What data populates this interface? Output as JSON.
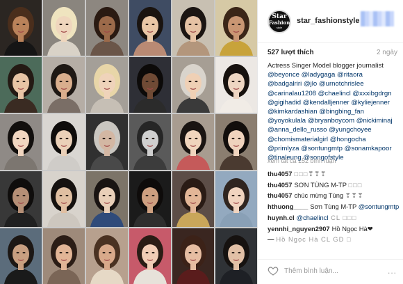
{
  "tiles": [
    {
      "bg": "#2b2622",
      "skin": "#b9825a",
      "hair": "#4a2e1c",
      "top": "#151515"
    },
    {
      "bg": "#8a857e",
      "skin": "#efd6bd",
      "hair": "#efe4bf",
      "top": "#d9d2c7"
    },
    {
      "bg": "#8d8780",
      "skin": "#9c6a4a",
      "hair": "#2a1a12",
      "top": "#6a5548"
    },
    {
      "bg": "#3f4c63",
      "skin": "#e9c7a6",
      "hair": "#1a1410",
      "top": "#b98a74"
    },
    {
      "bg": "#c8c0b2",
      "skin": "#e5c2a4",
      "hair": "#1b1512",
      "top": "#b3967c"
    },
    {
      "bg": "#d6c9a5",
      "skin": "#c99673",
      "hair": "#3b2618",
      "top": "#c8a33a"
    },
    {
      "bg": "#4c6b5a",
      "skin": "#e8c4a5",
      "hair": "#241a14",
      "top": "#3a2b22"
    },
    {
      "bg": "#b5ada5",
      "skin": "#d9ae8d",
      "hair": "#1e1814",
      "top": "#7a6e66"
    },
    {
      "bg": "#a49f98",
      "skin": "#efd3ba",
      "hair": "#e8d6a8",
      "top": "#c6bfb5"
    },
    {
      "bg": "#2e2f36",
      "skin": "#6f4a35",
      "hair": "#0c0a09",
      "top": "#2b2b2b"
    },
    {
      "bg": "#a69e94",
      "skin": "#efd0b5",
      "hair": "#d9d4cc",
      "top": "#3a3a3a"
    },
    {
      "bg": "#ece8e4",
      "skin": "#eed6c2",
      "hair": "#16110e",
      "top": "#f1ece6"
    },
    {
      "bg": "#8f8a86",
      "skin": "#f1d6c0",
      "hair": "#120f0d",
      "top": "#7c7670"
    },
    {
      "bg": "#d9d6d2",
      "skin": "#ead0b8",
      "hair": "#0e0c0b",
      "top": "#cfccc8"
    },
    {
      "bg": "#303030",
      "skin": "#d3b7a3",
      "hair": "#c9c6c0",
      "top": "#494949"
    },
    {
      "bg": "#5a5a5a",
      "skin": "#cfcfcf",
      "hair": "#262626",
      "top": "#3c3c3c"
    },
    {
      "bg": "#a89c90",
      "skin": "#f0d4bd",
      "hair": "#1a1412",
      "top": "#c55a5a"
    },
    {
      "bg": "#8b7e70",
      "skin": "#efd3bd",
      "hair": "#120e0c",
      "top": "#4a3a30"
    },
    {
      "bg": "#383838",
      "skin": "#b58f76",
      "hair": "#0f0d0c",
      "top": "#202020"
    },
    {
      "bg": "#d8d3cc",
      "skin": "#e0bfa2",
      "hair": "#15110f",
      "top": "#cdc7bf"
    },
    {
      "bg": "#7c7468",
      "skin": "#e9cfb8",
      "hair": "#191412",
      "top": "#2f4b7a"
    },
    {
      "bg": "#1b1b1b",
      "skin": "#cd9f80",
      "hair": "#0e0b0a",
      "top": "#2e2e2e"
    },
    {
      "bg": "#5c4d47",
      "skin": "#e3b697",
      "hair": "#2a1b15",
      "top": "#c9a65a"
    },
    {
      "bg": "#93a9bf",
      "skin": "#f0d4bf",
      "hair": "#2f2520",
      "top": "#89a0b6"
    },
    {
      "bg": "#5b6c7b",
      "skin": "#c89f80",
      "hair": "#1c1714",
      "top": "#1a1a1a"
    },
    {
      "bg": "#9e8a7a",
      "skin": "#e2b596",
      "hair": "#2b1d16",
      "top": "#7a6556"
    },
    {
      "bg": "#b7a08e",
      "skin": "#d8a98a",
      "hair": "#4a3222",
      "top": "#e6d9c6"
    },
    {
      "bg": "#c75a6a",
      "skin": "#f1cdb6",
      "hair": "#2a1c15",
      "top": "#e7e2da"
    },
    {
      "bg": "#3a2620",
      "skin": "#e6bda2",
      "hair": "#3c2218",
      "top": "#5a1c1c"
    },
    {
      "bg": "#2f3236",
      "skin": "#e2c0a6",
      "hair": "#161210",
      "top": "#1e2025"
    }
  ],
  "highlight_color": "#e3141f",
  "post": {
    "avatar_line1": "Star",
    "avatar_line2": "Fashion",
    "avatar_line3": "style",
    "username": "star_fashionstyle",
    "likes": "527 lượt thích",
    "time_ago": "2 ngày",
    "caption_text": "Actress Singer Model blogger journalist",
    "caption_tags": [
      "@beyonce @ladygaga @ritaora",
      "@badgalriri @jlo @urnotchrislee",
      "@carinalau1208 @chaelincl @xxxibgdrgn",
      "@gigihadid @kendalljenner @kyliejenner",
      "@kimkardashian @bingbing_fan",
      "@yoyokulala @bryanboycom @nickiminaj",
      "@anna_dello_russo @yungchoyee",
      "@chomismaterialgirl @hongocha",
      "@primlyza @sontungmtp @sonamkapoor",
      "@tinaleung @songofstyle"
    ],
    "view_comments": "xem tất cả 152 bình luận",
    "comments": [
      {
        "author": "thu4057",
        "pre": "",
        "mention": "",
        "text": "□□□❣❣❣"
      },
      {
        "author": "thu4057",
        "pre": "SƠN TÙNG M-TP ",
        "mention": "",
        "text": "□□□"
      },
      {
        "author": "thu4057",
        "pre": "chúc mừng Tùng ",
        "mention": "",
        "text": "❣❣❣"
      },
      {
        "author": "hthuong____",
        "pre": "Sơn Tùng M-TP ",
        "mention": "@sontungmtp",
        "text": ""
      },
      {
        "author": "huynh.cl",
        "pre": "",
        "mention": "@chaelincl",
        "text": " CL □□□"
      },
      {
        "author": "yennhi_nguyen2907",
        "pre": "Hồ Ngọc Hà❤",
        "mention": "",
        "text": ""
      },
      {
        "author": "—",
        "pre": "",
        "mention": "",
        "text": "Hồ Ngọc Hà CL GD □"
      }
    ],
    "comment_placeholder": "Thêm bình luận...",
    "more_glyph": "..."
  }
}
